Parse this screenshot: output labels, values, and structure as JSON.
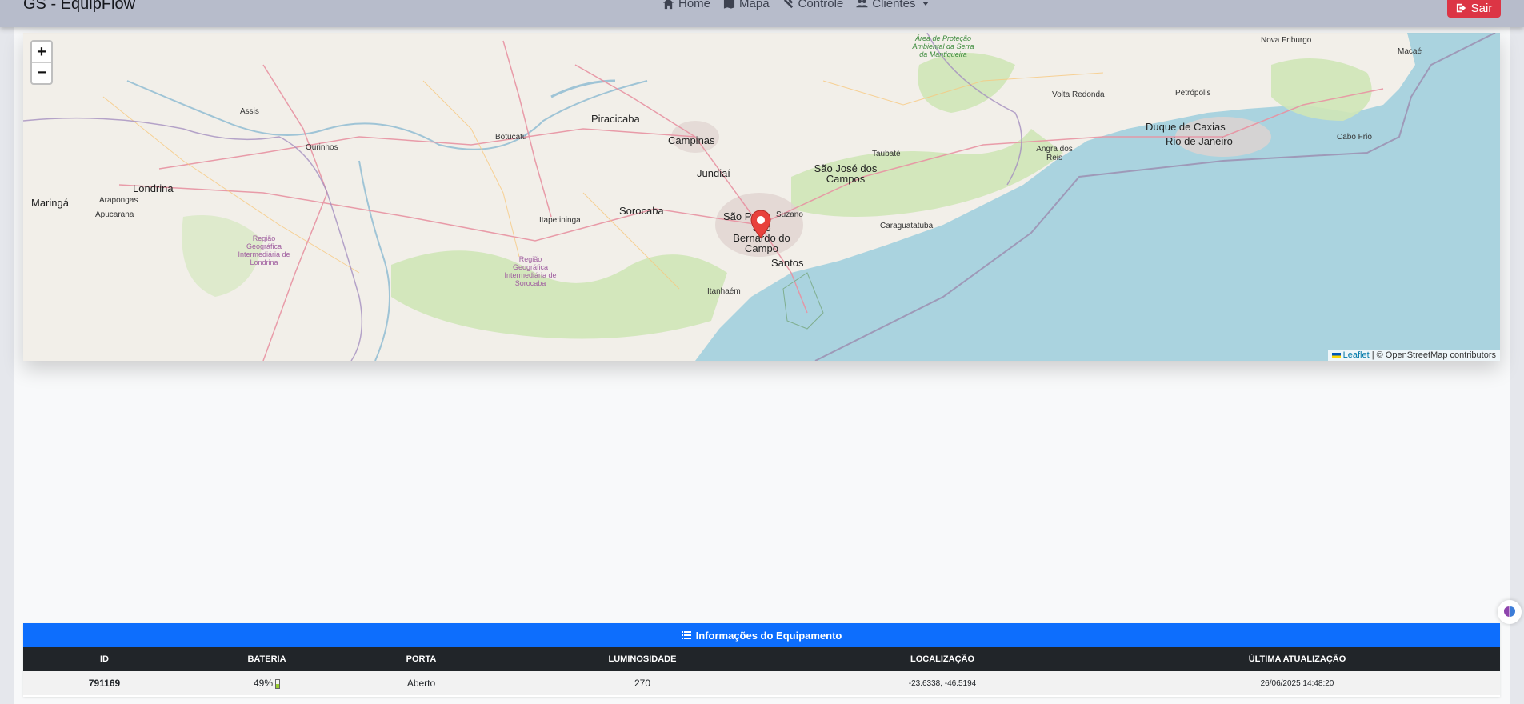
{
  "navbar": {
    "brand": "GS - EquipFlow",
    "links": [
      {
        "label": "Home",
        "icon": "home-icon"
      },
      {
        "label": "Mapa",
        "icon": "map-icon"
      },
      {
        "label": "Controle",
        "icon": "tools-icon"
      },
      {
        "label": "Clientes",
        "icon": "users-icon"
      }
    ],
    "logout_label": "Sair"
  },
  "map": {
    "zoom_in": "+",
    "zoom_out": "−",
    "attribution_leaflet": "Leaflet",
    "attribution_rest": " | © OpenStreetMap contributors",
    "labels": {
      "sao_paulo": "São Pa",
      "sao_bernardo": "São Bernardo do Campo",
      "santos": "Santos",
      "campinas": "Campinas",
      "sorocaba": "Sorocaba",
      "piracicaba": "Piracicaba",
      "jundiai": "Jundiaí",
      "sao_jose": "São José dos Campos",
      "rio": "Rio de Janeiro",
      "duque": "Duque de Caxias",
      "londrina": "Londrina",
      "maringa": "Maringá",
      "ourinhos": "Ourinhos",
      "botucatu": "Botucatu",
      "assis": "Assis",
      "itanhaem": "Itanhaém",
      "caraguatatuba": "Caraguatatuba",
      "taubate": "Taubaté",
      "petropolis": "Petrópolis",
      "volta_redonda": "Volta Redonda",
      "cabo_frio": "Cabo Frio",
      "angra": "Angra dos Reis",
      "suzano": "Suzano",
      "itapetininga": "Itapetininga",
      "apucarana": "Apucarana",
      "arapongas": "Arapongas",
      "nova_friburgo": "Nova Friburgo",
      "macae": "Macaé",
      "regiao_londrina": "Região Geográfica Intermediária de Londrina",
      "regiao_sorocaba": "Região Geográfica Intermediária de Sorocaba",
      "apa_mantiqueira": "Área de Proteção Ambiental da Serra da Mantiqueira"
    }
  },
  "panel": {
    "title": "Informações do Equipamento",
    "headers": [
      "ID",
      "BATERIA",
      "PORTA",
      "LUMINOSIDADE",
      "LOCALIZAÇÃO",
      "ÚLTIMA ATUALIZAÇÃO"
    ],
    "row": {
      "id": "791169",
      "battery": "49%",
      "battery_level": 0.49,
      "door": "Aberto",
      "luminosity": "270",
      "location": "-23.6338, -46.5194",
      "updated": "26/06/2025 14:48:20"
    }
  },
  "colors": {
    "primary": "#0d6efd",
    "danger": "#dc3545",
    "dark": "#212529",
    "sea": "#aad3df",
    "land": "#f2efe9"
  }
}
